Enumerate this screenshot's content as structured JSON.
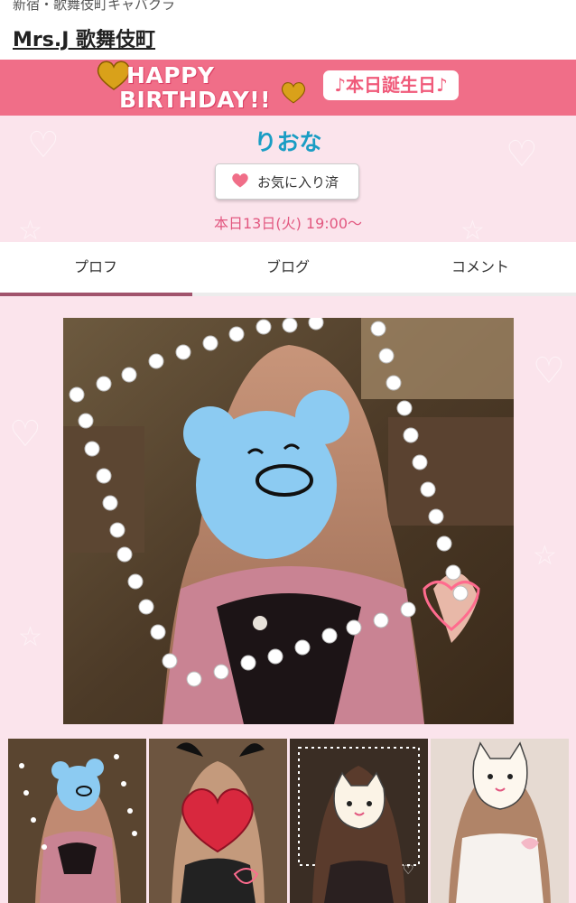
{
  "header": {
    "breadcrumb": "新宿・歌舞伎町キャバクラ",
    "store_name": "Mrs.J 歌舞伎町"
  },
  "banner": {
    "line1": "HAPPY",
    "line2": "BIRTHDAY!!",
    "birthday_pill": "♪本日誕生日♪"
  },
  "profile": {
    "name": "りおな",
    "favorite_label": "お気に入り済",
    "schedule": "本日13日(火) 19:00〜"
  },
  "tabs": [
    {
      "label": "プロフ",
      "active": true
    },
    {
      "label": "ブログ",
      "active": false
    },
    {
      "label": "コメント",
      "active": false
    }
  ],
  "colors": {
    "banner": "#f06e88",
    "profile_bg": "#fbe4ec",
    "name": "#1a9dc4",
    "schedule": "#e25880",
    "tab_active": "#a1536c"
  },
  "photos": {
    "main_stickers": [
      "blue-bear-face-sticker",
      "white-dots-frame",
      "pink-heart-doodle"
    ],
    "thumbnails": [
      {
        "sticker": "blue-bear-face-sticker"
      },
      {
        "sticker": "red-glitter-heart-sticker"
      },
      {
        "sticker": "white-cat-face-sticker"
      },
      {
        "sticker": "white-cat-face-sticker"
      }
    ]
  }
}
